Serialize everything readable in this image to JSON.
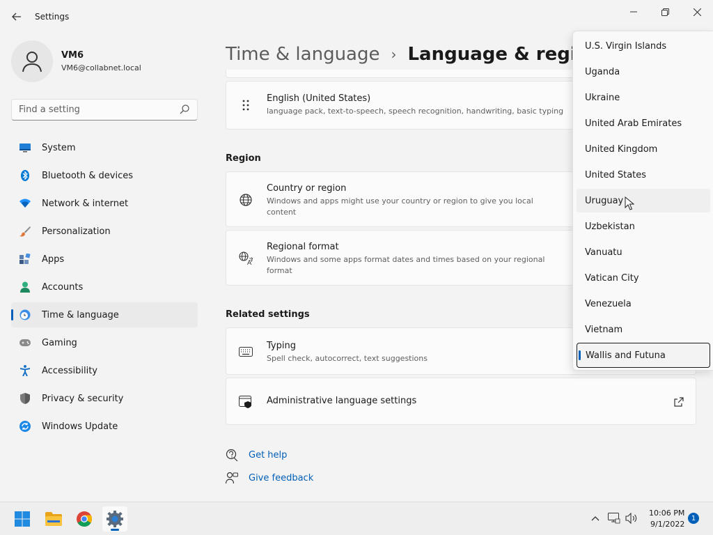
{
  "window": {
    "title": "Settings",
    "controls": [
      "minimize",
      "maximize",
      "close"
    ]
  },
  "account": {
    "name": "VM6",
    "email": "VM6@collabnet.local"
  },
  "search": {
    "placeholder": "Find a setting"
  },
  "sidebar": {
    "items": [
      {
        "label": "System",
        "icon": "monitor-icon",
        "color": "#0067c0"
      },
      {
        "label": "Bluetooth & devices",
        "icon": "bluetooth-icon",
        "color": "#0078d4"
      },
      {
        "label": "Network & internet",
        "icon": "wifi-icon",
        "color": "#1e90ff"
      },
      {
        "label": "Personalization",
        "icon": "brush-icon",
        "color": "#e07a3a"
      },
      {
        "label": "Apps",
        "icon": "apps-icon",
        "color": "#4a6fa5"
      },
      {
        "label": "Accounts",
        "icon": "person-icon",
        "color": "#2eaf7d"
      },
      {
        "label": "Time & language",
        "icon": "globe-clock-icon",
        "color": "#3a8ee6",
        "selected": true
      },
      {
        "label": "Gaming",
        "icon": "gamepad-icon",
        "color": "#7a7a7a"
      },
      {
        "label": "Accessibility",
        "icon": "accessibility-icon",
        "color": "#1a73c8"
      },
      {
        "label": "Privacy & security",
        "icon": "shield-icon",
        "color": "#6e6e6e"
      },
      {
        "label": "Windows Update",
        "icon": "update-icon",
        "color": "#1e88e5"
      }
    ]
  },
  "breadcrumb": {
    "parent": "Time & language",
    "separator": "›",
    "current": "Language & region"
  },
  "language_card": {
    "title": "English (United States)",
    "desc": "language pack, text-to-speech, speech recognition, handwriting, basic typing"
  },
  "region": {
    "heading": "Region",
    "country": {
      "title": "Country or region",
      "desc": "Windows and apps might use your country or region to give you local content"
    },
    "format": {
      "title": "Regional format",
      "desc": "Windows and some apps format dates and times based on your regional format"
    }
  },
  "related": {
    "heading": "Related settings",
    "typing": {
      "title": "Typing",
      "desc": "Spell check, autocorrect, text suggestions"
    },
    "admin": {
      "title": "Administrative language settings"
    }
  },
  "links": {
    "help": "Get help",
    "feedback": "Give feedback"
  },
  "country_dropdown": {
    "items": [
      "U.S. Virgin Islands",
      "Uganda",
      "Ukraine",
      "United Arab Emirates",
      "United Kingdom",
      "United States",
      "Uruguay",
      "Uzbekistan",
      "Vanuatu",
      "Vatican City",
      "Venezuela",
      "Vietnam",
      "Wallis and Futuna"
    ],
    "hovered": "Uruguay",
    "selected": "Wallis and Futuna"
  },
  "taskbar": {
    "apps": [
      "start-icon",
      "file-explorer-icon",
      "chrome-icon",
      "settings-icon"
    ],
    "active_app": "settings-icon",
    "clock_time": "10:06 PM",
    "clock_date": "9/1/2022",
    "notification_count": "1"
  },
  "colors": {
    "accent": "#005fb8",
    "background": "#f3f3f3",
    "card": "#fbfbfb"
  }
}
